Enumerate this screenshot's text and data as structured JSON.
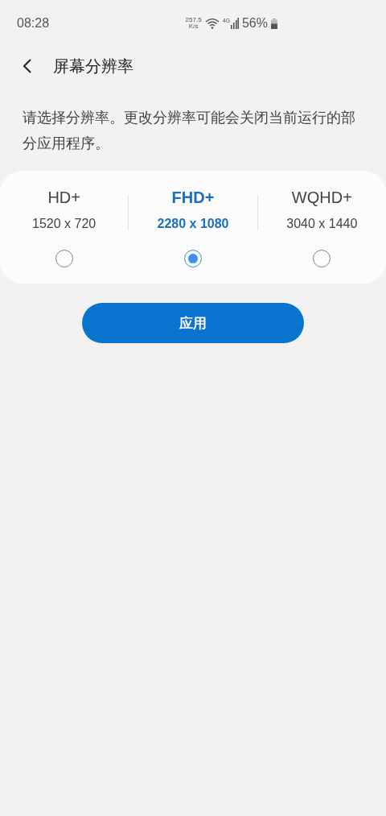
{
  "status_bar": {
    "time": "08:28",
    "speed_value": "257.5",
    "speed_unit": "K/s",
    "network": "4G",
    "battery": "56%"
  },
  "header": {
    "title": "屏幕分辨率"
  },
  "description": "请选择分辨率。更改分辨率可能会关闭当前运行的部分应用程序。",
  "options": [
    {
      "name": "HD+",
      "resolution": "1520 x 720",
      "selected": false
    },
    {
      "name": "FHD+",
      "resolution": "2280 x 1080",
      "selected": true
    },
    {
      "name": "WQHD+",
      "resolution": "3040 x 1440",
      "selected": false
    }
  ],
  "apply_button": "应用"
}
